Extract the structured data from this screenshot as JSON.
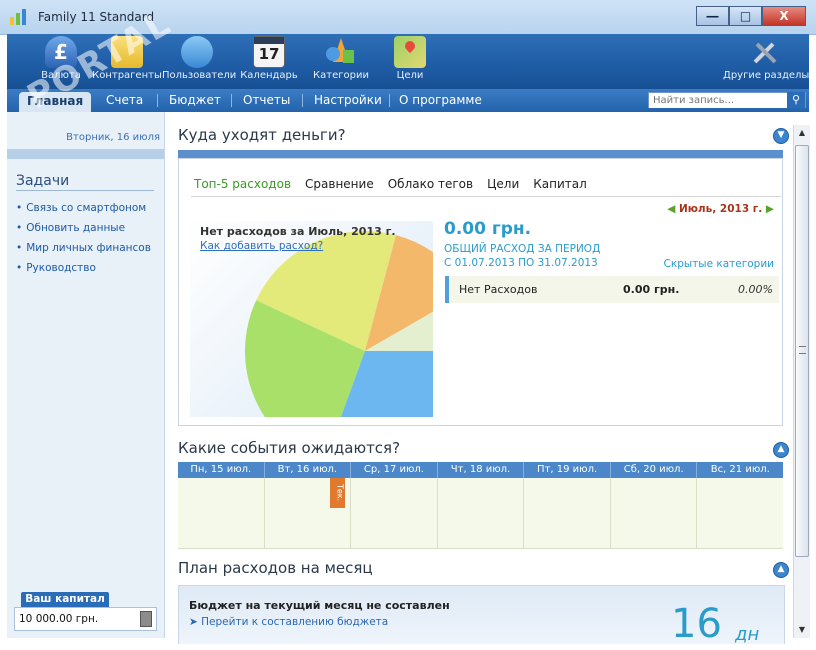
{
  "window": {
    "title": "Family 11 Standard",
    "buttons": [
      "―",
      "□",
      "X"
    ]
  },
  "toolbar": {
    "items": [
      {
        "label": "Валюта",
        "icon": "currency-icon"
      },
      {
        "label": "Контрагенты",
        "icon": "contractors-icon"
      },
      {
        "label": "Пользователи",
        "icon": "users-icon"
      },
      {
        "label": "Календарь",
        "icon": "calendar-icon"
      },
      {
        "label": "Категории",
        "icon": "categories-icon"
      },
      {
        "label": "Цели",
        "icon": "goals-icon"
      },
      {
        "label": "Другие разделы",
        "icon": "tools-icon"
      }
    ],
    "calendar_day": "17"
  },
  "nav": {
    "items": [
      "Главная",
      "Счета",
      "Бюджет",
      "Отчеты",
      "Настройки",
      "О программе"
    ],
    "active": "Главная",
    "search_placeholder": "Найти запись..."
  },
  "sidebar": {
    "date": "Вторник, 16 июля",
    "title": "Задачи",
    "links": [
      "Связь со смартфоном",
      "Обновить данные",
      "Мир личных финансов",
      "Руководство"
    ],
    "capital_label": "Ваш капитал",
    "capital_value": "10 000.00 грн."
  },
  "expenses": {
    "title": "Куда уходят деньги?",
    "tabs": [
      "Топ-5 расходов",
      "Сравнение",
      "Облако тегов",
      "Цели",
      "Капитал"
    ],
    "active_tab": "Топ-5 расходов",
    "month": "Июль, 2013 г.",
    "pie_title": "Нет расходов за Июль, 2013 г.",
    "pie_link": "Как добавить расход?",
    "amount": "0.00 грн.",
    "total_label": "ОБЩИЙ РАСХОД ЗА ПЕРИОД",
    "period": "С 01.07.2013 ПО 31.07.2013",
    "hidden_categories": "Скрытые категории",
    "row": {
      "name": "Нет Расходов",
      "amount": "0.00 грн.",
      "percent": "0.00%"
    },
    "pie_colors": [
      "#a8e06a",
      "#e3ea7a",
      "#f3b86a",
      "#e4efcf",
      "#6db7f0"
    ]
  },
  "events": {
    "title": "Какие события ожидаются?",
    "days": [
      "Пн, 15 июл.",
      "Вт, 16 июл.",
      "Ср, 17 июл.",
      "Чт, 18 июл.",
      "Пт, 19 июл.",
      "Сб, 20 июл.",
      "Вс, 21 июл."
    ],
    "today_tag": "Тек."
  },
  "plan": {
    "title": "План расходов на месяц",
    "text": "Бюджет на текущий месяц не составлен",
    "link": "Перейти к составлению бюджета",
    "days": "16",
    "days_unit": "дн"
  },
  "watermark": "PORTAL"
}
